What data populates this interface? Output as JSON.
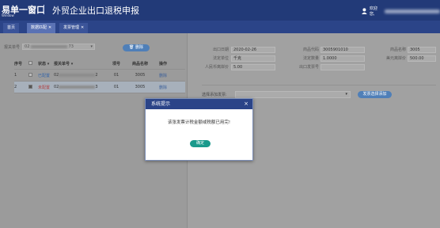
{
  "header": {
    "brand": "易单一窗口",
    "brand_sub": "Window",
    "title": "外贸企业出口退税申报",
    "welcome": "欢迎您,"
  },
  "tabs": [
    {
      "label": "首页"
    },
    {
      "label": "数据匹配"
    },
    {
      "label": "发票管理"
    }
  ],
  "left": {
    "search_label": "报关单号",
    "search_value_prefix": "02",
    "search_value_suffix": "73",
    "delete_button": "删除",
    "columns": [
      "序号",
      "状态",
      "报关单号",
      "项号",
      "商品名称",
      "操作"
    ],
    "rows": [
      {
        "no": "1",
        "status": "已配置",
        "decl_prefix": "02",
        "decl_suffix": "2",
        "item": "01",
        "code": "3005",
        "op": "删除"
      },
      {
        "no": "2",
        "status": "未配置",
        "decl_prefix": "02",
        "decl_suffix": "3",
        "item": "01",
        "code": "3005",
        "op": "删除"
      }
    ]
  },
  "right": {
    "fields": {
      "export_date_label": "出口日期",
      "export_date": "2020-02-26",
      "goods_code_label": "商品代码",
      "goods_code": "3005901010",
      "goods_name_label": "商品名称",
      "goods_name": "3005",
      "legal_unit_label": "法定单位",
      "legal_unit": "千克",
      "legal_qty_label": "法定数量",
      "legal_qty": "1.0000",
      "usd_total_label": "美元离岸价",
      "usd_total": "500.00",
      "rmb_total_label": "人民币离岸价",
      "rmb_total": "5.00",
      "export_invoice_label": "出口发票号"
    },
    "select_label": "选择添加发票:",
    "add_button": "发票选择添加"
  },
  "dialog": {
    "title": "系统提示",
    "message": "该张发票计税金额或税额已用完!",
    "ok": "确定"
  }
}
